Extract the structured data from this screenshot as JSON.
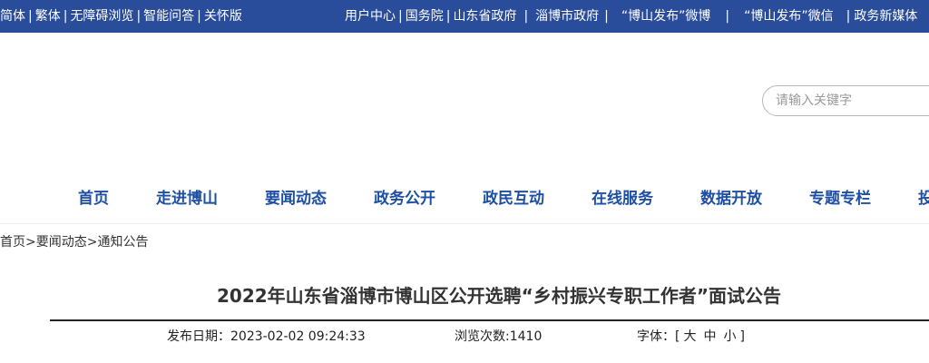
{
  "topbar": {
    "left_links": [
      "简体",
      "繁体",
      "无障碍浏览",
      "智能问答",
      "关怀版"
    ],
    "right_links": [
      "用户中心",
      "国务院",
      "山东省政府",
      "淄博市政府",
      "“博山发布”微博",
      "“博山发布”微信",
      "政务新媒体"
    ]
  },
  "search": {
    "placeholder": "请输入关键字"
  },
  "nav": {
    "items": [
      "首页",
      "走进博山",
      "要闻动态",
      "政务公开",
      "政民互动",
      "在线服务",
      "数据开放",
      "专题专栏",
      "投"
    ]
  },
  "breadcrumb": [
    "首页",
    "要闻动态",
    "通知公告"
  ],
  "article": {
    "title": "2022年山东省淄博市博山区公开选聘“乡村振兴专职工作者”面试公告",
    "publish_label": "发布日期：",
    "publish_date": "2023-02-02 09:24:33",
    "views_label": "浏览次数:",
    "views": "1410",
    "font_label": "字体：",
    "font_sizes": [
      "大",
      "中",
      "小"
    ]
  },
  "colors": {
    "topbar_bg": "#2a4d9b",
    "nav_text": "#1d4fa5"
  }
}
